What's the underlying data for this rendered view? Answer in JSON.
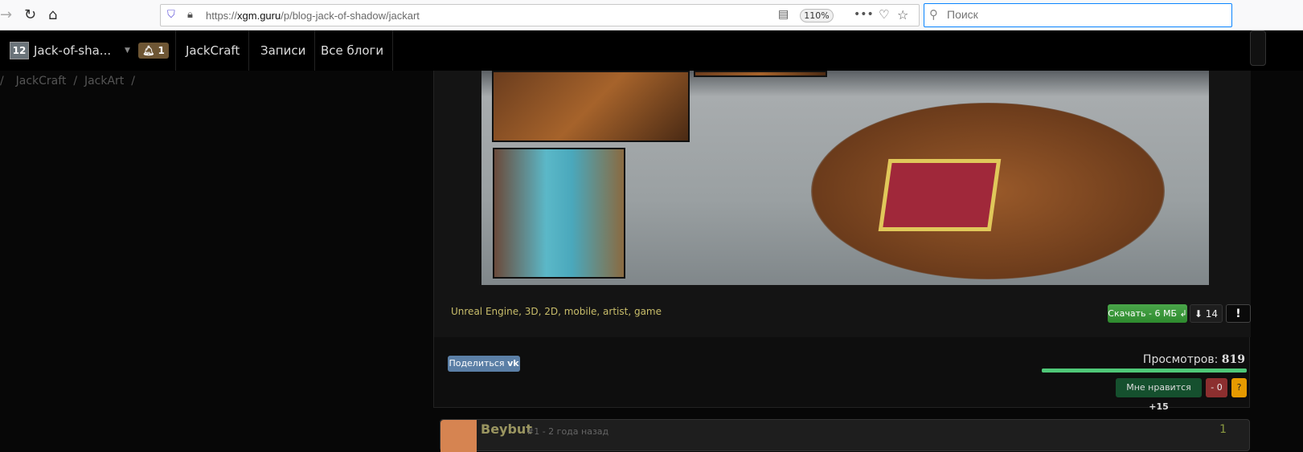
{
  "browser": {
    "url_prefix": "https://",
    "url_domain": "xgm.guru",
    "url_path": "/p/blog-jack-of-shadow/jackart",
    "zoom": "110%",
    "search_placeholder": "Поиск"
  },
  "nav": {
    "logo": "12",
    "user": "Jack-of-sha...",
    "notifications": "1",
    "items": [
      "JackCraft",
      "Записи",
      "Все блоги"
    ]
  },
  "breadcrumb": [
    "JackCraft",
    "JackArt"
  ],
  "post": {
    "tags": "Unreal Engine, 3D, 2D, mobile, artist, game",
    "download": "Скачать - 6 МБ ↲",
    "downloads": "14",
    "report": "!",
    "share": "Поделиться",
    "views_label": "Просмотров:",
    "views": "819",
    "views_bar": 1.0,
    "like": "Мне нравится",
    "like_count": "+15",
    "dislike": "- 0",
    "question": "?"
  },
  "comment": {
    "author": "Beybut",
    "meta": "#1 - 2 года назад",
    "score": "1"
  },
  "colors": {
    "accent": "#4fc878",
    "download": "#2e8a2e",
    "vk": "#5b7fa6"
  }
}
